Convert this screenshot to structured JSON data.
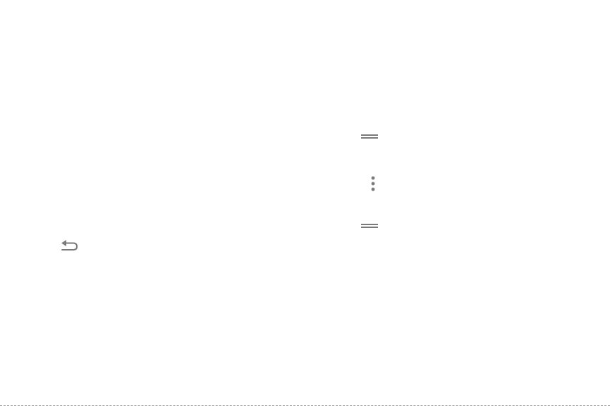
{
  "icons": {
    "back": "back-arrow-icon",
    "handle_top": "drag-handle-icon",
    "more": "more-options-icon",
    "handle_bottom": "drag-handle-icon"
  },
  "colors": {
    "background": "#ffffff",
    "icon": "#7a7a7a"
  }
}
